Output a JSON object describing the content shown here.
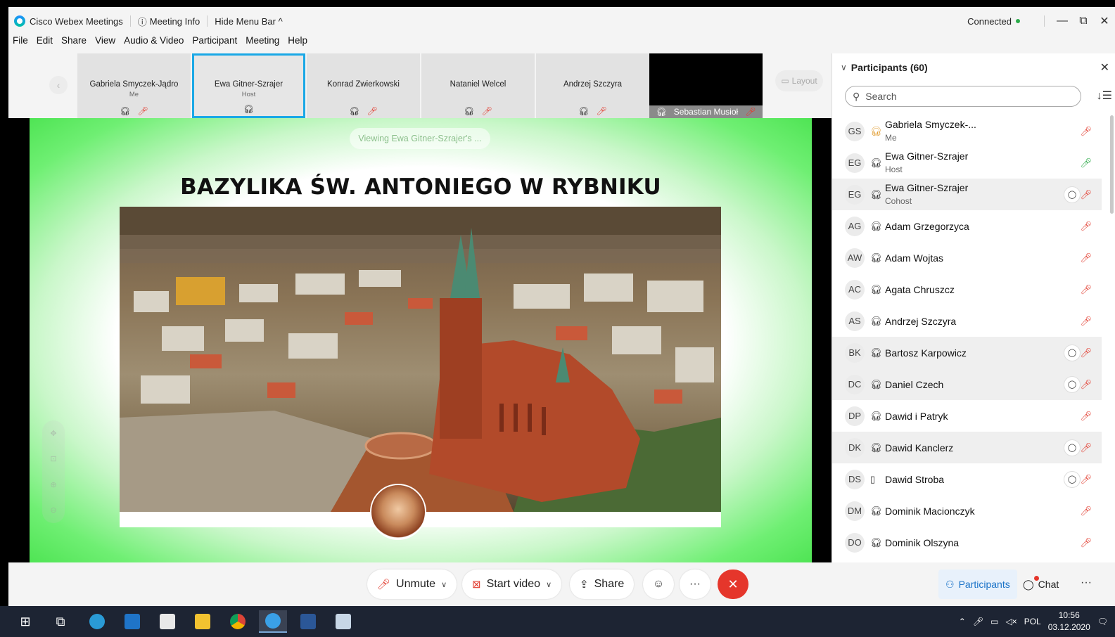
{
  "window": {
    "app_title": "Cisco Webex Meetings",
    "meeting_info": "Meeting Info",
    "hide_menu": "Hide Menu Bar ^",
    "status": "Connected",
    "controls": [
      "—",
      "⧉",
      "✕"
    ]
  },
  "menu": [
    "File",
    "Edit",
    "Share",
    "View",
    "Audio & Video",
    "Participant",
    "Meeting",
    "Help"
  ],
  "thumbs": [
    {
      "name": "Gabriela Smyczek-Jądro",
      "role": "Me",
      "active": false
    },
    {
      "name": "Ewa Gitner-Szrajer",
      "role": "Host",
      "active": true
    },
    {
      "name": "Konrad Zwierkowski",
      "role": "",
      "active": false
    },
    {
      "name": "Nataniel Welcel",
      "role": "",
      "active": false
    },
    {
      "name": "Andrzej Szczyra",
      "role": "",
      "active": false
    }
  ],
  "video_thumb": {
    "name": "Sebastian Musioł"
  },
  "layout_label": "Layout",
  "stage": {
    "viewing": "Viewing Ewa Gitner-Szrajer's ...",
    "slide_title": "BAZYLIKA ŚW. ANTONIEGO W RYBNIKU"
  },
  "participants": {
    "header": "Participants (60)",
    "search_placeholder": "Search",
    "list": [
      {
        "initials": "GS",
        "name": "Gabriela Smyczek-...",
        "sub": "Me",
        "chat": false,
        "mic": "off",
        "alt": false,
        "hs": "orange"
      },
      {
        "initials": "EG",
        "name": "Ewa Gitner-Szrajer",
        "sub": "Host",
        "chat": false,
        "mic": "on",
        "alt": false,
        "hs": "normal"
      },
      {
        "initials": "EG",
        "name": "Ewa Gitner-Szrajer",
        "sub": "Cohost",
        "chat": true,
        "mic": "off",
        "alt": true,
        "hs": "normal"
      },
      {
        "initials": "AG",
        "name": "Adam Grzegorzyca",
        "sub": "",
        "chat": false,
        "mic": "off",
        "alt": false,
        "hs": "normal"
      },
      {
        "initials": "AW",
        "name": "Adam Wojtas",
        "sub": "",
        "chat": false,
        "mic": "off",
        "alt": false,
        "hs": "normal"
      },
      {
        "initials": "AC",
        "name": "Agata Chruszcz",
        "sub": "",
        "chat": false,
        "mic": "off",
        "alt": false,
        "hs": "normal"
      },
      {
        "initials": "AS",
        "name": "Andrzej Szczyra",
        "sub": "",
        "chat": false,
        "mic": "off",
        "alt": false,
        "hs": "normal"
      },
      {
        "initials": "BK",
        "name": "Bartosz Karpowicz",
        "sub": "",
        "chat": true,
        "mic": "off",
        "alt": true,
        "hs": "normal"
      },
      {
        "initials": "DC",
        "name": "Daniel Czech",
        "sub": "",
        "chat": true,
        "mic": "off",
        "alt": true,
        "hs": "normal"
      },
      {
        "initials": "DP",
        "name": "Dawid i Patryk",
        "sub": "",
        "chat": false,
        "mic": "off",
        "alt": false,
        "hs": "normal"
      },
      {
        "initials": "DK",
        "name": "Dawid Kanclerz",
        "sub": "",
        "chat": true,
        "mic": "off",
        "alt": true,
        "hs": "normal"
      },
      {
        "initials": "DS",
        "name": "Dawid Stroba",
        "sub": "",
        "chat": true,
        "mic": "off",
        "alt": false,
        "hs": "phone"
      },
      {
        "initials": "DM",
        "name": "Dominik Macionczyk",
        "sub": "",
        "chat": false,
        "mic": "off",
        "alt": false,
        "hs": "normal"
      },
      {
        "initials": "DO",
        "name": "Dominik Olszyna",
        "sub": "",
        "chat": false,
        "mic": "off",
        "alt": false,
        "hs": "normal"
      }
    ]
  },
  "controls": {
    "unmute": "Unmute",
    "start_video": "Start video",
    "share": "Share",
    "more": "···",
    "participants": "Participants",
    "chat": "Chat"
  },
  "taskbar": {
    "lang": "POL",
    "time": "10:56",
    "date": "03.12.2020"
  },
  "colors": {
    "accent": "#1a73c8",
    "active_border": "#1aa8e6",
    "end_call": "#e5362b",
    "mic_off": "#e23b2e",
    "mic_on": "#27a844",
    "share_glow": "#6fef73"
  }
}
